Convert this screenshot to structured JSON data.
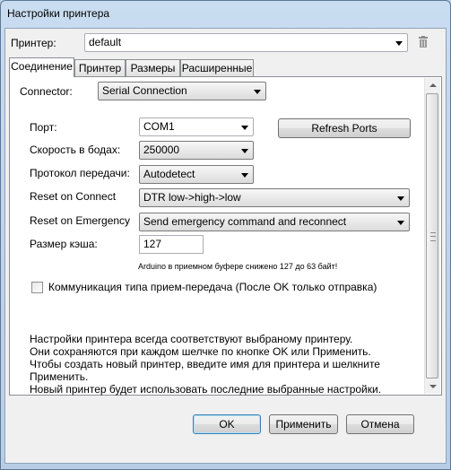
{
  "window": {
    "title": "Настройки принтера"
  },
  "printer": {
    "label": "Принтер:",
    "value": "default"
  },
  "tabs": [
    {
      "label": "Соединение"
    },
    {
      "label": "Принтер"
    },
    {
      "label": "Размеры"
    },
    {
      "label": "Расширенные"
    }
  ],
  "connection": {
    "connector_label": "Connector:",
    "connector_value": "Serial Connection",
    "port_label": "Порт:",
    "port_value": "COM1",
    "refresh_label": "Refresh Ports",
    "baud_label": "Скорость в бодах:",
    "baud_value": "250000",
    "protocol_label": "Протокол передачи:",
    "protocol_value": "Autodetect",
    "reset_connect_label": "Reset on Connect",
    "reset_connect_value": "DTR low->high->low",
    "reset_emergency_label": "Reset on Emergency",
    "reset_emergency_value": "Send emergency command and reconnect",
    "cache_label": "Размер кэша:",
    "cache_value": "127",
    "cache_note": "Arduino в приемном буфере снижено 127 до 63 байт!",
    "pingpong_label": "Коммуникация типа прием-передача (После OK только отправка)",
    "pingpong_checked": false,
    "info_lines": [
      "Настройки принтера всегда соответствуют выбраному принтеру.",
      "Они сохраняются при каждом шелчке по кнопке OK или Применить.",
      "Чтобы создать новый принтер, введите имя для принтера и шелкните",
      "Применить.",
      "Новый принтер будет использовать последние выбранные настройки."
    ]
  },
  "buttons": {
    "ok": "OK",
    "apply": "Применить",
    "cancel": "Отмена"
  },
  "colors": {
    "title_bar": "#c9dcf0",
    "accent": "#3c7fb1"
  },
  "icons": {
    "delete": "trash-icon",
    "dropdown": "chevron-down-icon"
  }
}
